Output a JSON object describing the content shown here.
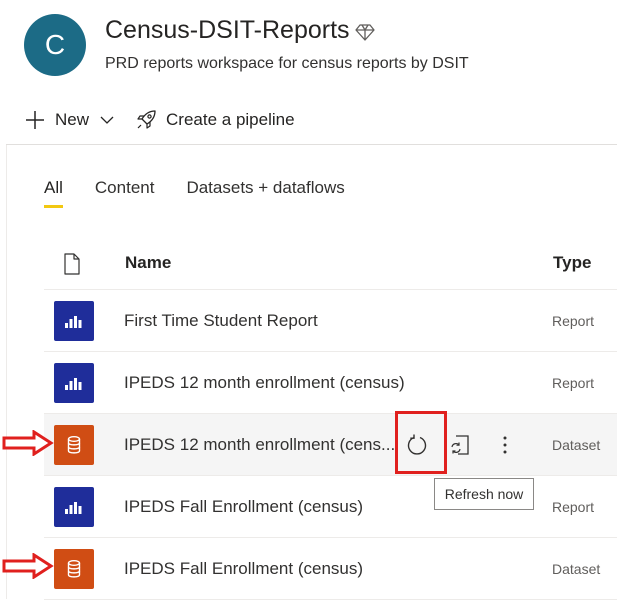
{
  "workspace": {
    "avatar_letter": "C",
    "title": "Census-DSIT-Reports",
    "description": "PRD reports workspace for census reports by DSIT"
  },
  "toolbar": {
    "new_label": "New",
    "pipeline_label": "Create a pipeline"
  },
  "tabs": [
    {
      "label": "All",
      "active": true
    },
    {
      "label": "Content",
      "active": false
    },
    {
      "label": "Datasets + dataflows",
      "active": false
    }
  ],
  "table": {
    "columns": {
      "name": "Name",
      "type": "Type"
    },
    "rows": [
      {
        "name": "First Time Student Report",
        "type": "Report",
        "kind": "report"
      },
      {
        "name": "IPEDS 12 month enrollment (census)",
        "type": "Report",
        "kind": "report"
      },
      {
        "name": "IPEDS 12 month enrollment (cens...",
        "type": "Dataset",
        "kind": "dataset"
      },
      {
        "name": "IPEDS Fall Enrollment (census)",
        "type": "Report",
        "kind": "report"
      },
      {
        "name": "IPEDS Fall Enrollment (census)",
        "type": "Dataset",
        "kind": "dataset"
      }
    ]
  },
  "tooltip": "Refresh now",
  "colors": {
    "report_tile": "#1f2d9a",
    "dataset_tile": "#d04d14",
    "tab_underline": "#f2c811",
    "annotation_red": "#e0201e"
  },
  "icons": [
    "diamond-icon",
    "plus-icon",
    "chevron-down-icon",
    "rocket-icon",
    "document-icon",
    "report-icon",
    "dataset-icon",
    "refresh-icon",
    "schedule-refresh-icon",
    "more-options-icon",
    "red-arrow"
  ]
}
